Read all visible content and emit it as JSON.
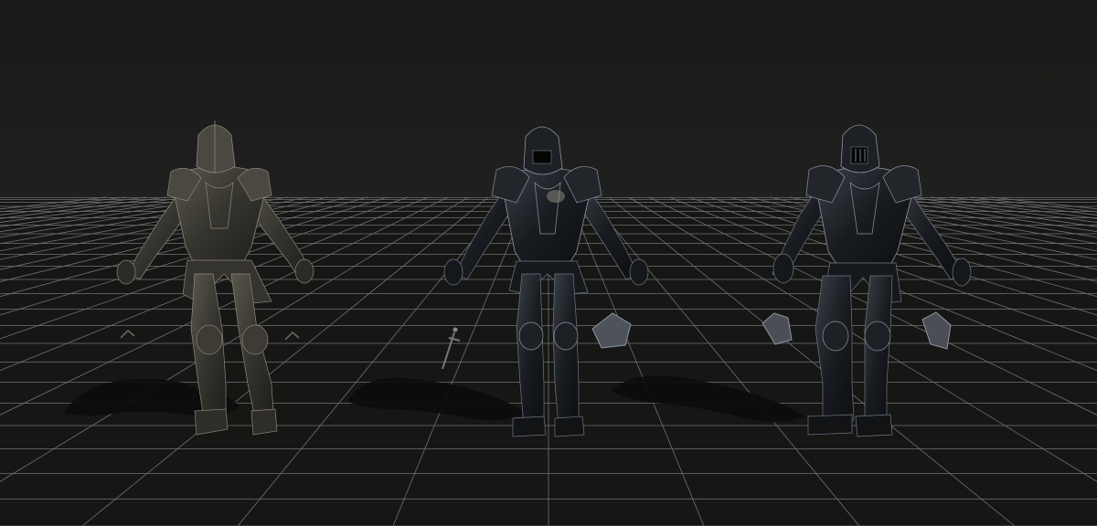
{
  "scene": {
    "background_color": "#1b1a19",
    "floor_color": "#161615",
    "grid_color": "#8f8f8f",
    "shadow_color": "#0b0b0b",
    "armor_dark_color": "#121417",
    "armor_mid_color": "#2a2e33",
    "armor_highlight_color": "#8b95a0",
    "weathered_armor_color": "#3b3932",
    "weathered_highlight_color": "#8a8878"
  },
  "objects": [
    {
      "name": "knight-weathered-armor",
      "variant": "weathered"
    },
    {
      "name": "knight-black-armor-ornate",
      "variant": "dark-ornate"
    },
    {
      "name": "knight-black-armor-plated",
      "variant": "dark-plated"
    }
  ],
  "props": [
    {
      "name": "sword-prop"
    },
    {
      "name": "helmet-prop-left"
    },
    {
      "name": "helmet-prop-middle"
    },
    {
      "name": "helmet-prop-right"
    }
  ]
}
